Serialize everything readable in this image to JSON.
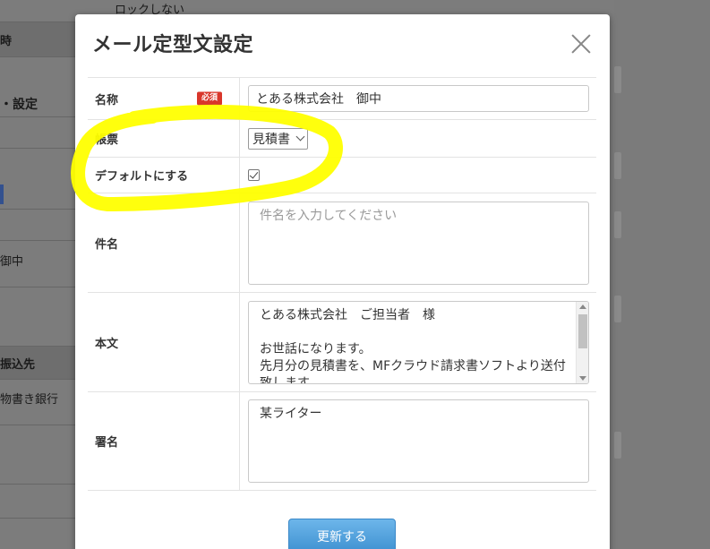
{
  "background": {
    "lock_text": "ロックしない",
    "row_time": "時",
    "section_settings": "設定",
    "row_onchu": "御中",
    "section_transfer": "振込先",
    "bank_text": "物書き銀行"
  },
  "modal": {
    "title": "メール定型文設定",
    "fields": {
      "name_label": "名称",
      "required_badge": "必須",
      "name_value": "とある株式会社　御中",
      "form_label": "帳票",
      "form_value": "見積書",
      "default_label": "デフォルトにする",
      "subject_label": "件名",
      "subject_placeholder": "件名を入力してください",
      "body_label": "本文",
      "body_lines": [
        "とある株式会社　ご担当者　様",
        "",
        "お世話になります。",
        "先月分の見積書を、MFクラウド請求書ソフトより送付",
        "致します。"
      ],
      "signature_label": "署名",
      "signature_value": "某ライター"
    },
    "update_button": "更新する"
  },
  "colors": {
    "highlight": "#ffff00",
    "required": "#d9362b",
    "button": "#4a9ad9"
  }
}
